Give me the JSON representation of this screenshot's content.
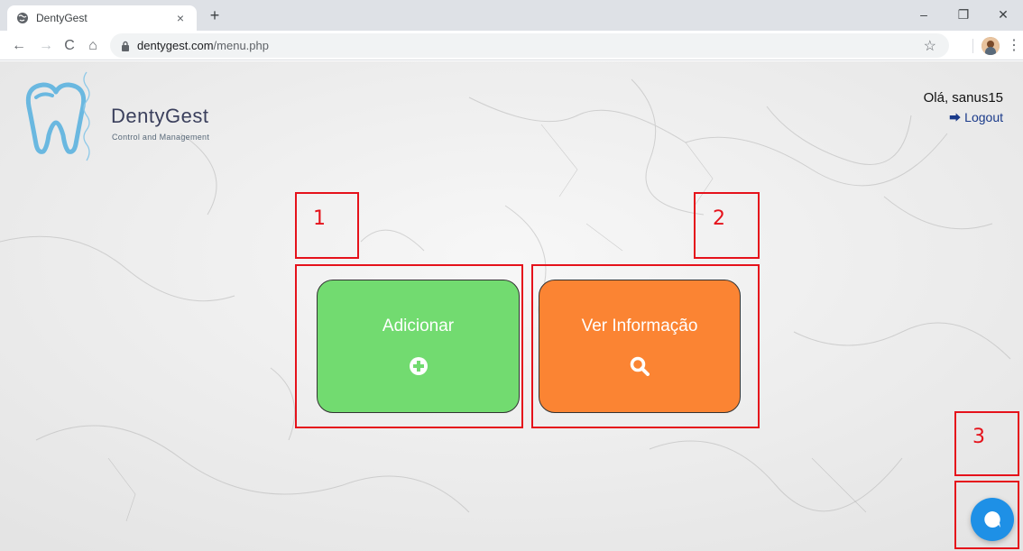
{
  "browser": {
    "tab_title": "DentyGest",
    "tab_close": "×",
    "new_tab": "+",
    "url_host": "dentygest.com",
    "url_path": "/menu.php",
    "window_controls": {
      "minimize": "–",
      "restore": "❐",
      "close": "✕"
    },
    "nav": {
      "back": "←",
      "forward": "→",
      "reload": "C",
      "home": "⌂"
    },
    "star": "☆",
    "menu": "⋮"
  },
  "header": {
    "brand_name": "DentyGest",
    "brand_tagline": "Control and Management",
    "greeting": "Olá, sanus15",
    "logout_label": "Logout"
  },
  "actions": [
    {
      "label": "Adicionar",
      "icon": "plus-circle-icon",
      "color": "#72db70"
    },
    {
      "label": "Ver Informação",
      "icon": "search-icon",
      "color": "#fb8433"
    }
  ],
  "annotations": [
    "1",
    "2",
    "3"
  ],
  "chat": {
    "icon": "chat-bubble-icon",
    "color": "#1e90e6"
  },
  "colors": {
    "callout": "#e5121b",
    "logo_blue": "#6ab8e0",
    "brand_text": "#3a3f5c"
  }
}
